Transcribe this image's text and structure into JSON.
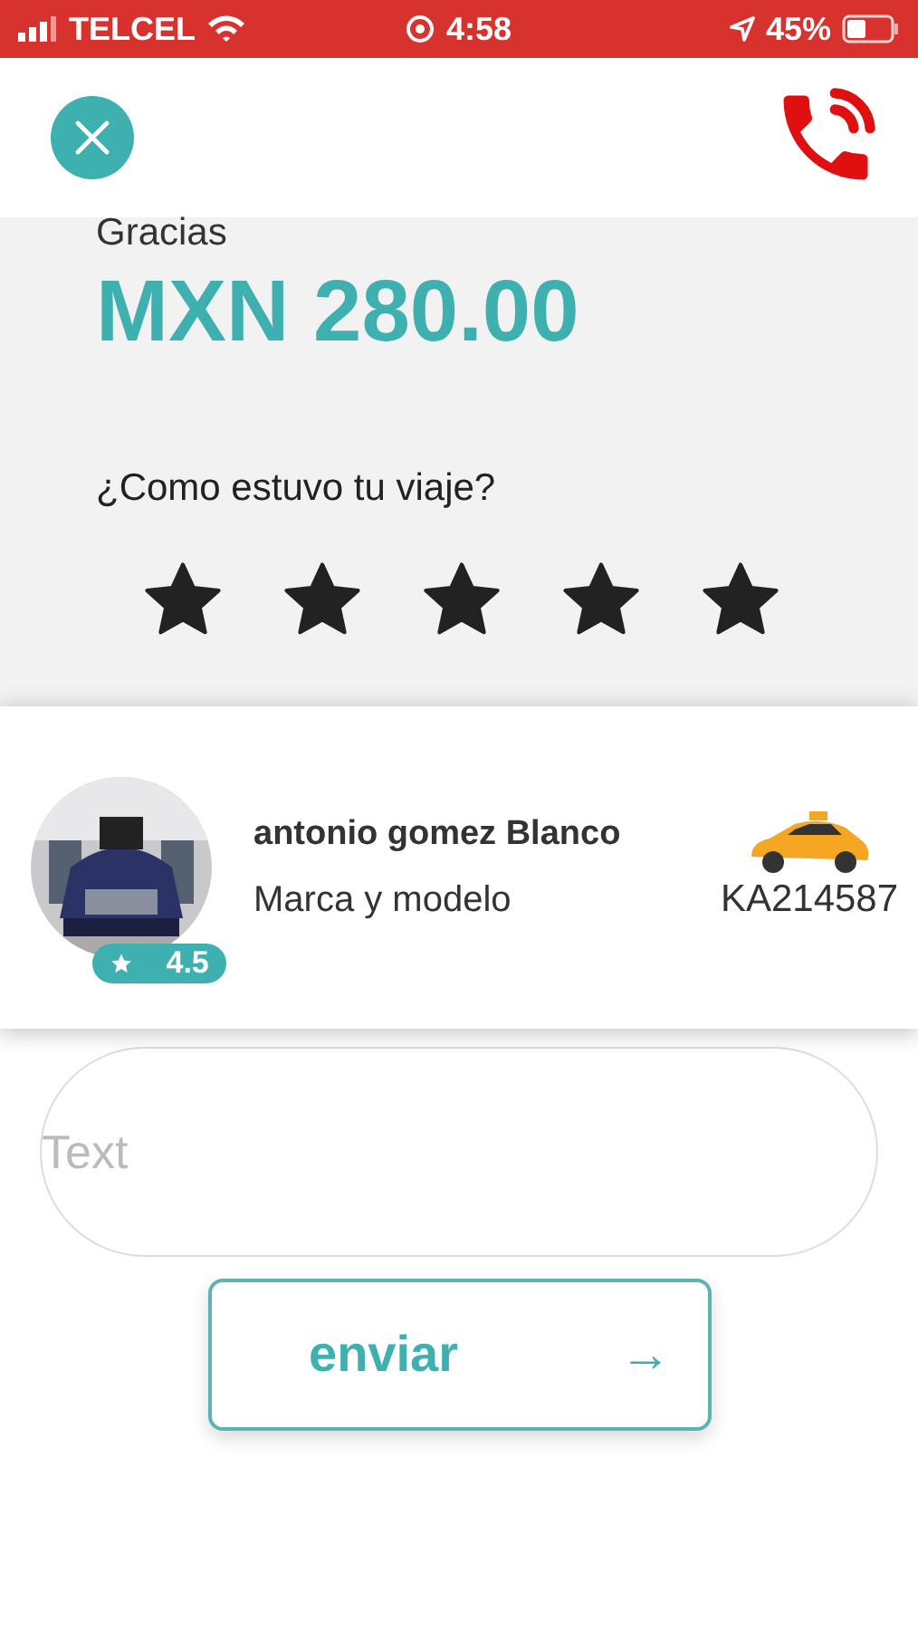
{
  "status_bar": {
    "carrier": "TELCEL",
    "time": "4:58",
    "battery": "45%"
  },
  "summary": {
    "title": "Gracias",
    "amount": "MXN 280.00",
    "question": "¿Como estuvo tu viaje?",
    "rating": {
      "stars": 5
    }
  },
  "driver": {
    "name": "antonio gomez Blanco",
    "vehicle": "Marca y modelo",
    "rating": "4.5",
    "plate": "KA214587"
  },
  "comment": {
    "placeholder": "Text"
  },
  "send_button": {
    "label": "enviar",
    "icon": "→"
  }
}
